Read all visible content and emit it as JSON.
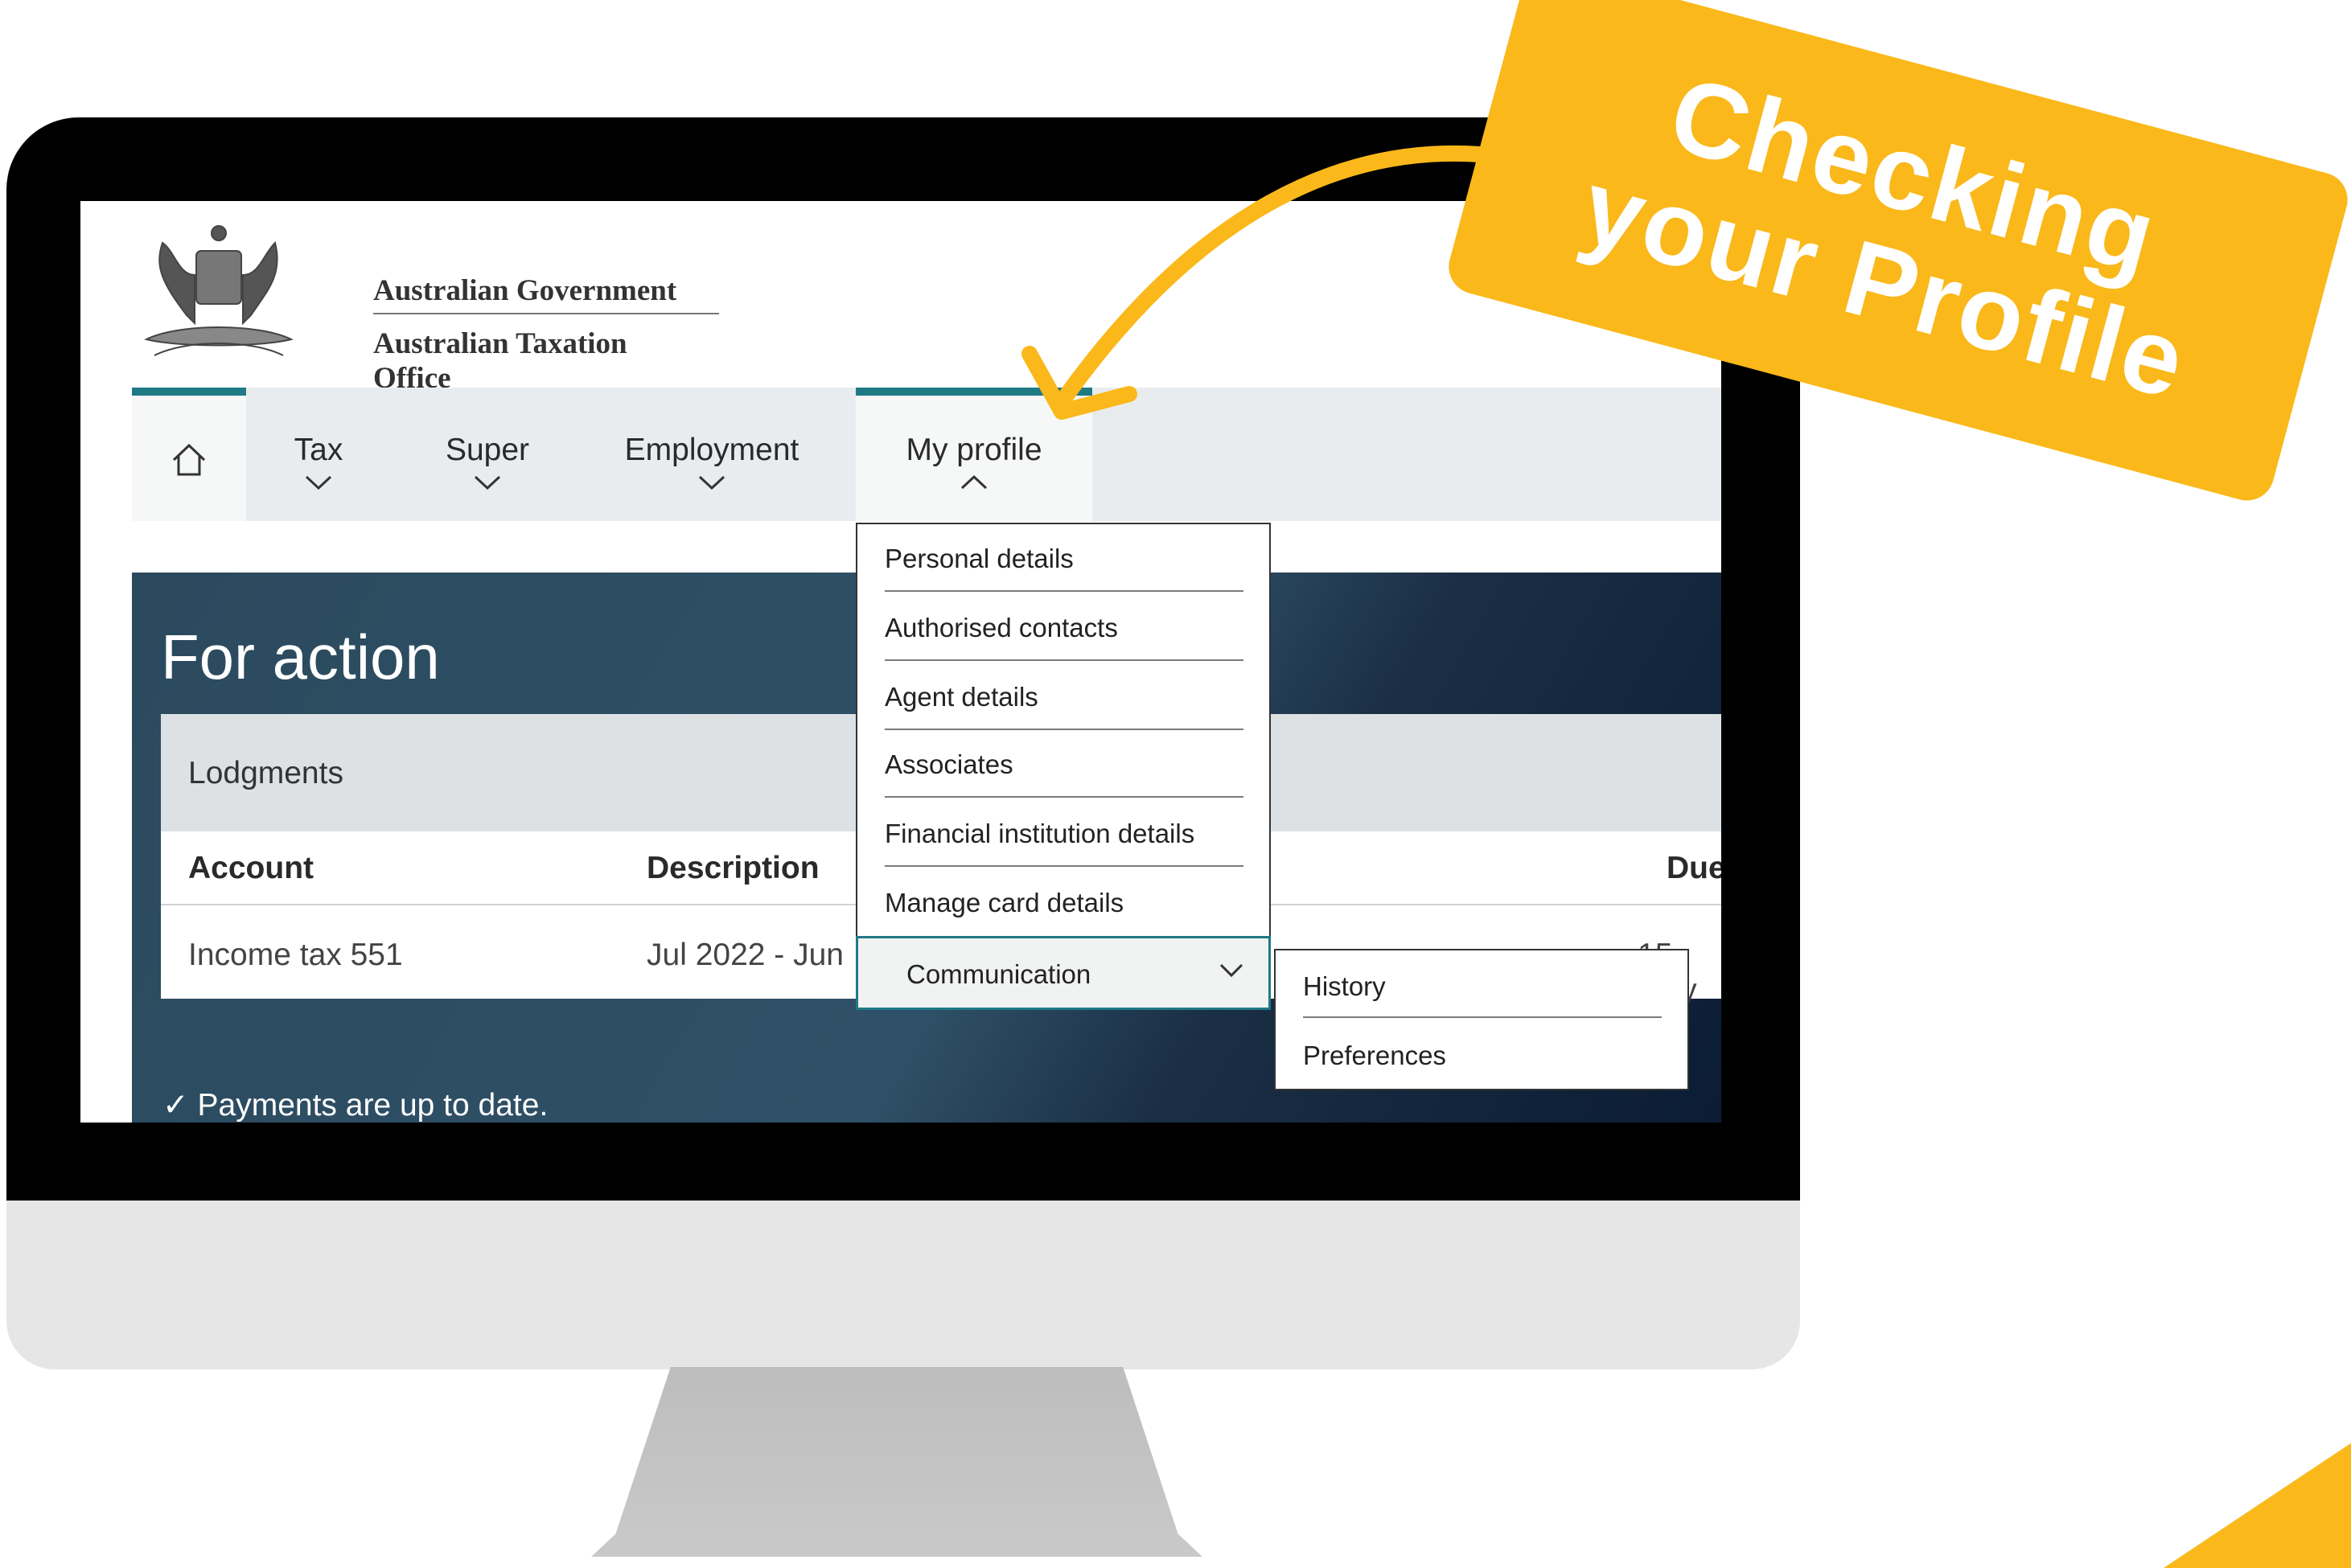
{
  "colors": {
    "accent_teal": "#1f7a86",
    "callout_yellow": "#fab81a",
    "panel_dark": "#2b4a5e"
  },
  "header": {
    "government": "Australian Government",
    "agency": "Australian Taxation Office"
  },
  "nav": {
    "home_icon": "home-icon",
    "items": [
      {
        "label": "Tax"
      },
      {
        "label": "Super"
      },
      {
        "label": "Employment"
      },
      {
        "label": "My profile"
      }
    ]
  },
  "for_action": {
    "title": "For action",
    "section": "Lodgments",
    "columns": [
      "Account",
      "Description",
      "Due"
    ],
    "rows": [
      {
        "account": "Income tax 551",
        "description": "Jul 2022 - Jun",
        "due": "15 May"
      }
    ],
    "payments_status": "Payments are up to date."
  },
  "profile_menu": {
    "items": [
      "Personal details",
      "Authorised contacts",
      "Agent details",
      "Associates",
      "Financial institution details",
      "Manage card details",
      "Communication"
    ],
    "submenu": [
      "History",
      "Preferences"
    ]
  },
  "callout": {
    "line1": "Checking",
    "line2": "your Profile"
  }
}
